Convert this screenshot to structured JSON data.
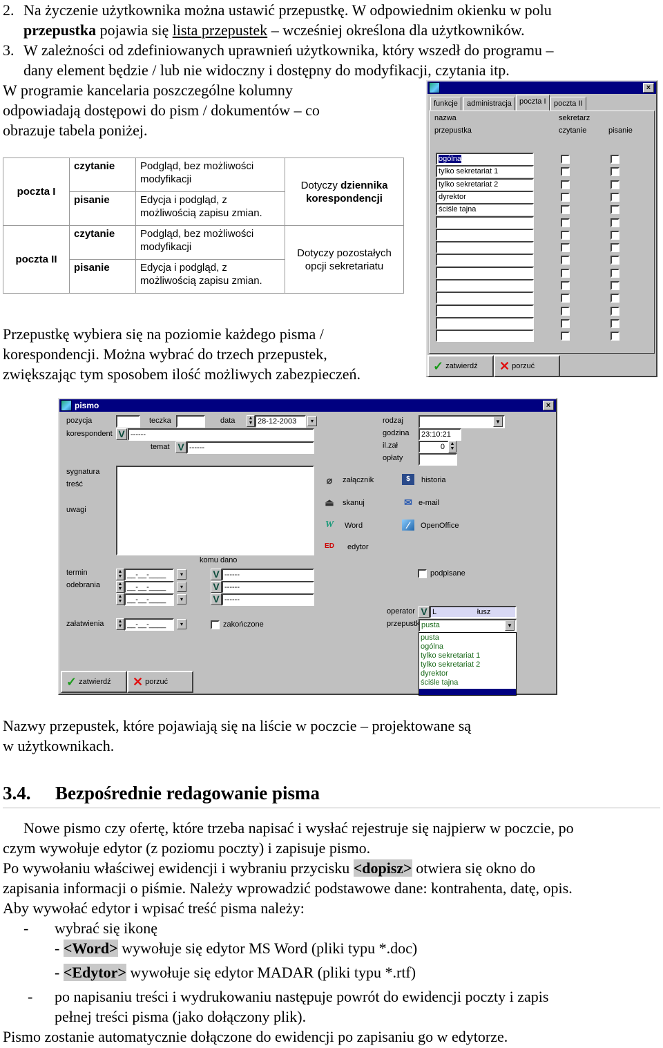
{
  "list_items": [
    {
      "number": "2.",
      "line1": "Na życzenie użytkownika można ustawić przepustkę. W odpowiednim okienku w polu",
      "line2_bold": "przepustka",
      "line2_mid": " pojawia się ",
      "line2_underline": "lista przepustek",
      "line2_end": " – wcześniej określona dla użytkowników."
    },
    {
      "number": "3.",
      "line1": "W zależności od  zdefiniowanych uprawnień użytkownika, który wszedł do programu –",
      "line2": "dany element będzie / lub nie widoczny i dostępny do modyfikacji, czytania itp."
    }
  ],
  "intro_paragraph": [
    "W programie kancelaria poszczególne kolumny",
    "odpowiadają dostępowi do pism / dokumentów – co",
    "obrazuje tabela poniżej."
  ],
  "access_table": {
    "groups": [
      {
        "name": "poczta I",
        "rows": [
          {
            "mode": "czytanie",
            "desc": [
              "Podgląd, bez możliwości",
              "modyfikacji"
            ]
          },
          {
            "mode": "pisanie",
            "desc": [
              "Edycja i podgląd, z",
              "możliwością zapisu zmian."
            ]
          }
        ],
        "scope_prefix": "Dotyczy ",
        "scope_bold1": "dziennika",
        "scope_bold2": "korespondencji"
      },
      {
        "name": "poczta II",
        "rows": [
          {
            "mode": "czytanie",
            "desc": [
              "Podgląd, bez możliwości",
              "modyfikacji"
            ]
          },
          {
            "mode": "pisanie",
            "desc": [
              "Edycja i podgląd, z",
              "możliwością zapisu zmian."
            ]
          }
        ],
        "scope_line1": "Dotyczy pozostałych",
        "scope_line2": "opcji sekretariatu"
      }
    ]
  },
  "after_table_paragraph": [
    "Przepustkę wybiera się na poziomie każdego pisma /",
    "korespondencji. Można wybrać do trzech przepustek,",
    "zwiększając tym sposobem ilość możliwych zabezpieczeń."
  ],
  "user_dialog": {
    "title": "",
    "close_label": "×",
    "tabs": [
      "funkcje",
      "administracja",
      "poczta I",
      "poczta II"
    ],
    "active_tab": "poczta I",
    "header_nazwa": "nazwa",
    "header_przepustka": "przepustka",
    "header_sekretarz": "sekretarz",
    "header_czytanie": "czytanie",
    "header_pisanie": "pisanie",
    "rows": [
      "ogólna",
      "tylko sekretariat 1",
      "tylko sekretariat 2",
      "dyrektor",
      "ściśle tajna",
      "",
      "",
      "",
      "",
      "",
      "",
      "",
      "",
      "",
      ""
    ],
    "selected_row": "ogólna",
    "confirm_label": "zatwierdź",
    "cancel_label": "porzuć"
  },
  "pismo_dialog": {
    "title": "pismo",
    "close_label": "×",
    "labels": {
      "pozycja": "pozycja",
      "teczka": "teczka",
      "data": "data",
      "korespondent": "korespondent",
      "temat": "temat",
      "sygnatura": "sygnatura",
      "tresc": "treść",
      "uwagi": "uwagi",
      "komu_dano": "komu dano",
      "termin": "termin",
      "odebrania": "odebrania",
      "zalatwienia": "załatwienia",
      "rodzaj": "rodzaj",
      "godzina": "godzina",
      "il_zal": "il.zał",
      "oplaty": "opłaty",
      "operator": "operator",
      "przepustka": "przepustka"
    },
    "values": {
      "pozycja": "",
      "teczka": "",
      "data": "28-12-2003",
      "korespondent": "------",
      "temat": "------",
      "rodzaj": "",
      "godzina": "23:10:21",
      "il_zal": "0",
      "oplaty": "",
      "date_placeholder": "__-__-____",
      "komu_dano": [
        "------",
        "------",
        "------"
      ],
      "operator_initial": "L",
      "operator_name": "łusz",
      "przepustka": "pusta"
    },
    "actions": [
      {
        "name": "attachment",
        "label": "załącznik",
        "icon": "paperclip-icon"
      },
      {
        "name": "history",
        "label": "historia",
        "icon": "history-icon"
      },
      {
        "name": "scan",
        "label": "skanuj",
        "icon": "scanner-icon"
      },
      {
        "name": "email",
        "label": "e-mail",
        "icon": "email-icon"
      },
      {
        "name": "word",
        "label": "Word",
        "icon": "word-icon"
      },
      {
        "name": "openoffice",
        "label": "OpenOffice",
        "icon": "openoffice-icon"
      },
      {
        "name": "editor",
        "label": "edytor",
        "icon": "editor-icon"
      }
    ],
    "checkbox_podpisane": "podpisane",
    "checkbox_zakonczone": "zakończone",
    "przepustka_options": [
      "pusta",
      "ogólna",
      "tylko sekretariat 1",
      "tylko sekretariat 2",
      "dyrektor",
      "ściśle tajna"
    ],
    "confirm_label": "zatwierdź",
    "cancel_label": "porzuć"
  },
  "after_dialog_paragraph": [
    "Nazwy przepustek, które pojawiają się na liście w poczcie – projektowane są",
    "w użytkownikach."
  ],
  "section": {
    "number": "3.4.",
    "title": "Bezpośrednie redagowanie pisma"
  },
  "section_body": {
    "p1_line1": "Nowe pismo czy ofertę, które trzeba napisać i wysłać rejestruje się najpierw w poczcie, po",
    "p1_line2": "czym wywołuje edytor (z poziomu poczty) i zapisuje pismo.",
    "p2_line1_pre": "Po wywołaniu właściwej ewidencji i wybraniu przycisku ",
    "p2_line1_btn": "<dopisz>",
    "p2_line1_post": " otwiera się okno do",
    "p2_line2": "zapisania informacji o piśmie. Należy wprowadzić podstawowe dane: kontrahenta, datę, opis.",
    "p3": "Aby wywołać edytor i wpisać treść pisma należy:",
    "bullet1": "wybrać się ikonę",
    "sub1_btn": "<Word>",
    "sub1_text": " wywołuje się edytor MS Word (pliki typu *.doc)",
    "sub2_btn": "<Edytor>",
    "sub2_text": " wywołuje się edytor MADAR (pliki typu *.rtf)",
    "bullet2_line1": "po napisaniu treści i wydrukowaniu następuje powrót do ewidencji poczty i zapis",
    "bullet2_line2": "pełnej treści pisma (jako dołączony plik).",
    "closing": "Pismo zostanie automatycznie dołączone do ewidencji po zapisaniu go w edytorze.",
    "dash": "-",
    "sub_dash": "- "
  }
}
